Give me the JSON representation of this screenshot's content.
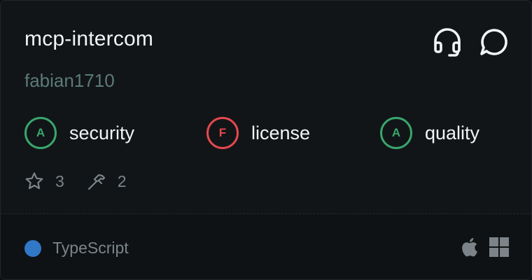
{
  "card": {
    "title": "mcp-intercom",
    "author": "fabian1710",
    "header_icons": [
      "headset-icon",
      "chat-bubble-icon"
    ],
    "grades": [
      {
        "grade": "A",
        "label": "security",
        "color": "#3aa56c"
      },
      {
        "grade": "F",
        "label": "license",
        "color": "#e5484d"
      },
      {
        "grade": "A",
        "label": "quality",
        "color": "#3aa56c"
      }
    ],
    "stats": {
      "stars": "3",
      "tools": "2"
    },
    "footer": {
      "language": "TypeScript",
      "language_color": "#3178c6",
      "platforms": [
        "apple-icon",
        "windows-icon"
      ]
    }
  }
}
